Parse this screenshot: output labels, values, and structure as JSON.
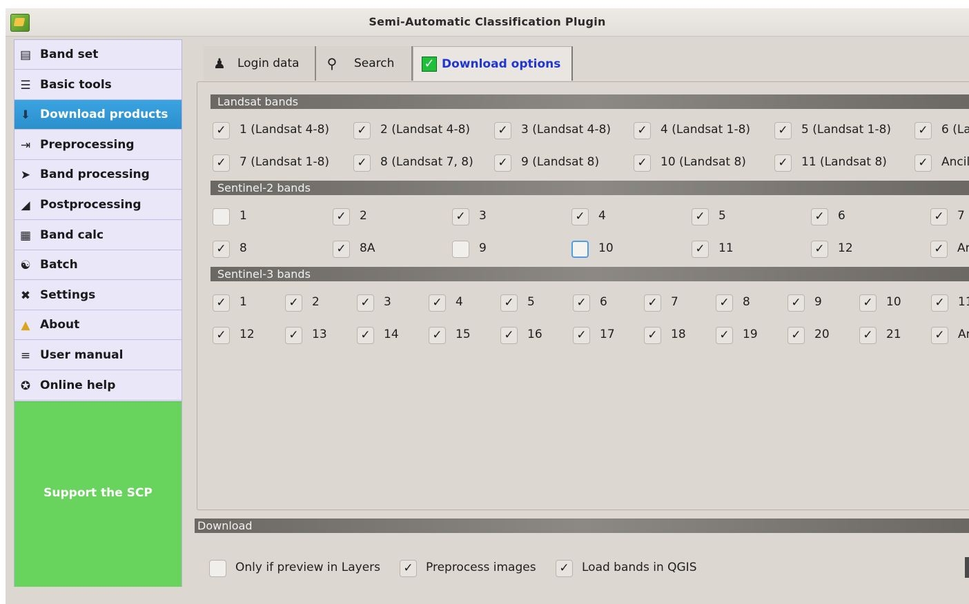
{
  "window": {
    "title": "Semi-Automatic Classification Plugin"
  },
  "sidebar": {
    "items": [
      {
        "label": "Band set",
        "icon": "band-set-icon"
      },
      {
        "label": "Basic tools",
        "icon": "basic-tools-icon"
      },
      {
        "label": "Download products",
        "icon": "download-icon",
        "active": true
      },
      {
        "label": "Preprocessing",
        "icon": "preprocessing-icon"
      },
      {
        "label": "Band processing",
        "icon": "band-processing-icon"
      },
      {
        "label": "Postprocessing",
        "icon": "postprocessing-icon"
      },
      {
        "label": "Band calc",
        "icon": "calculator-icon"
      },
      {
        "label": "Batch",
        "icon": "batch-icon"
      },
      {
        "label": "Settings",
        "icon": "settings-icon"
      },
      {
        "label": "About",
        "icon": "about-icon"
      },
      {
        "label": "User manual",
        "icon": "book-icon"
      },
      {
        "label": "Online help",
        "icon": "help-icon"
      }
    ],
    "support_label": "Support the SCP"
  },
  "tabs": [
    {
      "label": "Login data",
      "icon": "user-icon"
    },
    {
      "label": "Search",
      "icon": "search-icon"
    },
    {
      "label": "Download options",
      "icon": "check-icon",
      "active": true
    }
  ],
  "landsat": {
    "title": "Landsat bands",
    "bands": [
      {
        "label": "1 (Landsat 4-8)",
        "checked": true
      },
      {
        "label": "2 (Landsat 4-8)",
        "checked": true
      },
      {
        "label": "3 (Landsat 4-8)",
        "checked": true
      },
      {
        "label": "4 (Landsat 1-8)",
        "checked": true
      },
      {
        "label": "5 (Landsat 1-8)",
        "checked": true
      },
      {
        "label": "6 (La",
        "checked": true
      },
      {
        "label": "7 (Landsat 1-8)",
        "checked": true
      },
      {
        "label": "8 (Landsat 7, 8)",
        "checked": true
      },
      {
        "label": "9 (Landsat 8)",
        "checked": true
      },
      {
        "label": "10 (Landsat 8)",
        "checked": true
      },
      {
        "label": "11 (Landsat 8)",
        "checked": true
      },
      {
        "label": "Ancil",
        "checked": true
      }
    ]
  },
  "sentinel2": {
    "title": "Sentinel-2 bands",
    "bands": [
      {
        "label": "1",
        "checked": false
      },
      {
        "label": "2",
        "checked": true
      },
      {
        "label": "3",
        "checked": true
      },
      {
        "label": "4",
        "checked": true
      },
      {
        "label": "5",
        "checked": true
      },
      {
        "label": "6",
        "checked": true
      },
      {
        "label": "7",
        "checked": true
      },
      {
        "label": "8",
        "checked": true
      },
      {
        "label": "8A",
        "checked": true
      },
      {
        "label": "9",
        "checked": false
      },
      {
        "label": "10",
        "checked": false,
        "focused": true
      },
      {
        "label": "11",
        "checked": true
      },
      {
        "label": "12",
        "checked": true
      },
      {
        "label": "Ar",
        "checked": true
      }
    ]
  },
  "sentinel3": {
    "title": "Sentinel-3 bands",
    "bands": [
      {
        "label": "1",
        "checked": true
      },
      {
        "label": "2",
        "checked": true
      },
      {
        "label": "3",
        "checked": true
      },
      {
        "label": "4",
        "checked": true
      },
      {
        "label": "5",
        "checked": true
      },
      {
        "label": "6",
        "checked": true
      },
      {
        "label": "7",
        "checked": true
      },
      {
        "label": "8",
        "checked": true
      },
      {
        "label": "9",
        "checked": true
      },
      {
        "label": "10",
        "checked": true
      },
      {
        "label": "11",
        "checked": true
      },
      {
        "label": "12",
        "checked": true
      },
      {
        "label": "13",
        "checked": true
      },
      {
        "label": "14",
        "checked": true
      },
      {
        "label": "15",
        "checked": true
      },
      {
        "label": "16",
        "checked": true
      },
      {
        "label": "17",
        "checked": true
      },
      {
        "label": "18",
        "checked": true
      },
      {
        "label": "19",
        "checked": true
      },
      {
        "label": "20",
        "checked": true
      },
      {
        "label": "21",
        "checked": true
      },
      {
        "label": "Ar",
        "checked": true
      }
    ]
  },
  "download": {
    "title": "Download",
    "options": [
      {
        "label": "Only if preview in Layers",
        "checked": false
      },
      {
        "label": "Preprocess images",
        "checked": true
      },
      {
        "label": "Load bands in QGIS",
        "checked": true
      }
    ]
  },
  "colors": {
    "accent": "#2b8fcd",
    "support": "#69d45d",
    "active_tab_text": "#1f36d3"
  }
}
